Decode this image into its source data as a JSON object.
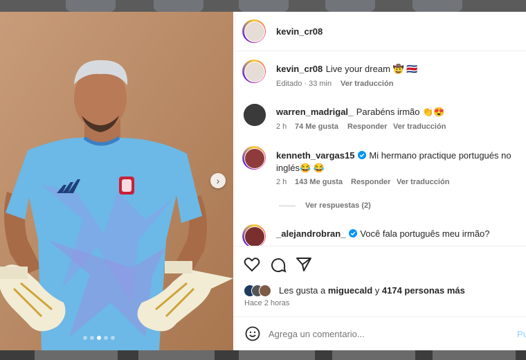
{
  "post": {
    "author": "kevin_cr08",
    "carousel_index": 3,
    "carousel_total": 5
  },
  "caption": {
    "username": "kevin_cr08",
    "text": "Live your dream 🤠 🇨🇷",
    "edited": "Editado · 33 min",
    "translate": "Ver traducción"
  },
  "comments": [
    {
      "username": "warren_madrigal_",
      "verified": false,
      "text": "Parabéns irmão 👏😍",
      "time": "2 h",
      "likes": "74 Me gusta",
      "reply": "Responder",
      "translate": "Ver traducción"
    },
    {
      "username": "kenneth_vargas15",
      "verified": true,
      "text_line1": "Mi hermano practique portugués no",
      "text_line2": "inglés😂 😂",
      "time": "2 h",
      "likes": "143 Me gusta",
      "reply": "Responder",
      "translate": "Ver traducción",
      "view_replies": "Ver respuestas (2)"
    },
    {
      "username": "_alejandrobran_",
      "verified": true,
      "text": "Você fala português meu irmão?"
    }
  ],
  "likes": {
    "prefix": "Les gusta a",
    "user": "miguecald",
    "joiner": "y",
    "others": "4174 personas más",
    "posted": "Hace 2 horas"
  },
  "composer": {
    "placeholder": "Agrega un comentario...",
    "post_label": "Pu"
  },
  "colors": {
    "link": "#0095f6",
    "verified": "#0095f6",
    "jersey": "#6cb8e6",
    "backdrop": "#b98b69"
  },
  "icons": [
    "heart-icon",
    "comment-icon",
    "share-icon",
    "emoji-icon",
    "verified-icon",
    "chevron-right-icon"
  ]
}
